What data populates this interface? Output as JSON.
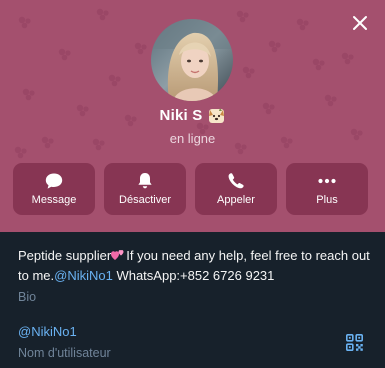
{
  "header": {
    "name": "Niki S",
    "status": "en ligne",
    "background_color": "#a4506e",
    "close_icon": "close-icon",
    "name_emoji_icon": "dog-emoji-icon"
  },
  "actions": [
    {
      "label": "Message",
      "icon": "chat-bubble-icon"
    },
    {
      "label": "Désactiver",
      "icon": "bell-icon"
    },
    {
      "label": "Appeler",
      "icon": "phone-icon"
    },
    {
      "label": "Plus",
      "icon": "more-dots-icon"
    }
  ],
  "bio": {
    "text_before_emoji": "Peptide supplier",
    "emoji_icon": "two-hearts-icon",
    "text_after_emoji": "If you need any help, feel free to reach out to me.",
    "mention": "@NikiNo1",
    "text_after_mention": " WhatsApp:+852 6726 9231",
    "label": "Bio"
  },
  "username": {
    "value": "@NikiNo1",
    "label": "Nom d'utilisateur",
    "qr_icon": "qr-code-icon"
  },
  "colors": {
    "link": "#6ab2f2",
    "panel_background": "#17212b",
    "caption": "#708499"
  }
}
